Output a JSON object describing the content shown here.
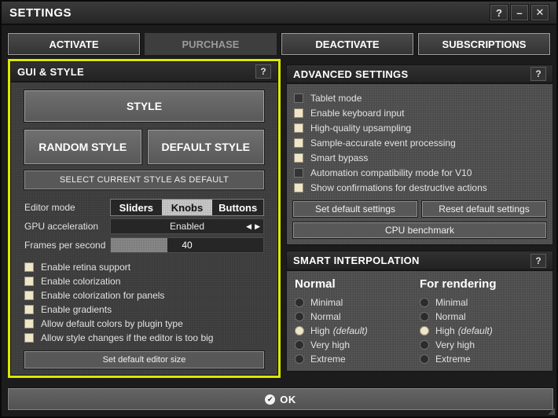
{
  "window": {
    "title": "SETTINGS",
    "buttons": {
      "help": "?",
      "minimize": "–",
      "close": "✕"
    }
  },
  "tabs": [
    {
      "label": "ACTIVATE",
      "enabled": true
    },
    {
      "label": "PURCHASE",
      "enabled": false
    },
    {
      "label": "DEACTIVATE",
      "enabled": true
    },
    {
      "label": "SUBSCRIPTIONS",
      "enabled": true
    }
  ],
  "gui_style": {
    "title": "GUI & STYLE",
    "help": "?",
    "style_button": "STYLE",
    "random_style_button": "RANDOM STYLE",
    "default_style_button": "DEFAULT STYLE",
    "select_current_style_button": "SELECT CURRENT STYLE AS DEFAULT",
    "editor_mode": {
      "label": "Editor mode",
      "options": [
        {
          "label": "Sliders",
          "selected": false
        },
        {
          "label": "Knobs",
          "selected": true
        },
        {
          "label": "Buttons",
          "selected": false
        }
      ]
    },
    "gpu_acceleration": {
      "label": "GPU acceleration",
      "value": "Enabled",
      "left_arrow": "◀",
      "right_arrow": "▶"
    },
    "frames_per_second": {
      "label": "Frames per second",
      "value": "40",
      "fill_percent": 37
    },
    "checkboxes": [
      {
        "label": "Enable retina support",
        "checked": true
      },
      {
        "label": "Enable colorization",
        "checked": true
      },
      {
        "label": "Enable colorization for panels",
        "checked": true
      },
      {
        "label": "Enable gradients",
        "checked": true
      },
      {
        "label": "Allow default colors by plugin type",
        "checked": true
      },
      {
        "label": "Allow style changes if the editor is too big",
        "checked": true
      }
    ],
    "set_default_editor_size_button": "Set default editor size"
  },
  "advanced": {
    "title": "ADVANCED SETTINGS",
    "help": "?",
    "checkboxes": [
      {
        "label": "Tablet mode",
        "checked": false
      },
      {
        "label": "Enable keyboard input",
        "checked": true
      },
      {
        "label": "High-quality upsampling",
        "checked": true
      },
      {
        "label": "Sample-accurate event processing",
        "checked": true
      },
      {
        "label": "Smart bypass",
        "checked": true
      },
      {
        "label": "Automation compatibility mode for V10",
        "checked": false
      },
      {
        "label": "Show confirmations for destructive actions",
        "checked": true
      }
    ],
    "set_default_button": "Set default settings",
    "reset_default_button": "Reset default settings",
    "cpu_benchmark_button": "CPU benchmark"
  },
  "interpolation": {
    "title": "SMART INTERPOLATION",
    "help": "?",
    "columns": [
      {
        "heading": "Normal",
        "options": [
          {
            "label": "Minimal",
            "note": "",
            "selected": false
          },
          {
            "label": "Normal",
            "note": "",
            "selected": false
          },
          {
            "label": "High",
            "note": "(default)",
            "selected": true
          },
          {
            "label": "Very high",
            "note": "",
            "selected": false
          },
          {
            "label": "Extreme",
            "note": "",
            "selected": false
          }
        ]
      },
      {
        "heading": "For rendering",
        "options": [
          {
            "label": "Minimal",
            "note": "",
            "selected": false
          },
          {
            "label": "Normal",
            "note": "",
            "selected": false
          },
          {
            "label": "High",
            "note": "(default)",
            "selected": true
          },
          {
            "label": "Very high",
            "note": "",
            "selected": false
          },
          {
            "label": "Extreme",
            "note": "",
            "selected": false
          }
        ]
      }
    ]
  },
  "footer": {
    "ok_label": "OK",
    "ok_icon": "✔"
  }
}
